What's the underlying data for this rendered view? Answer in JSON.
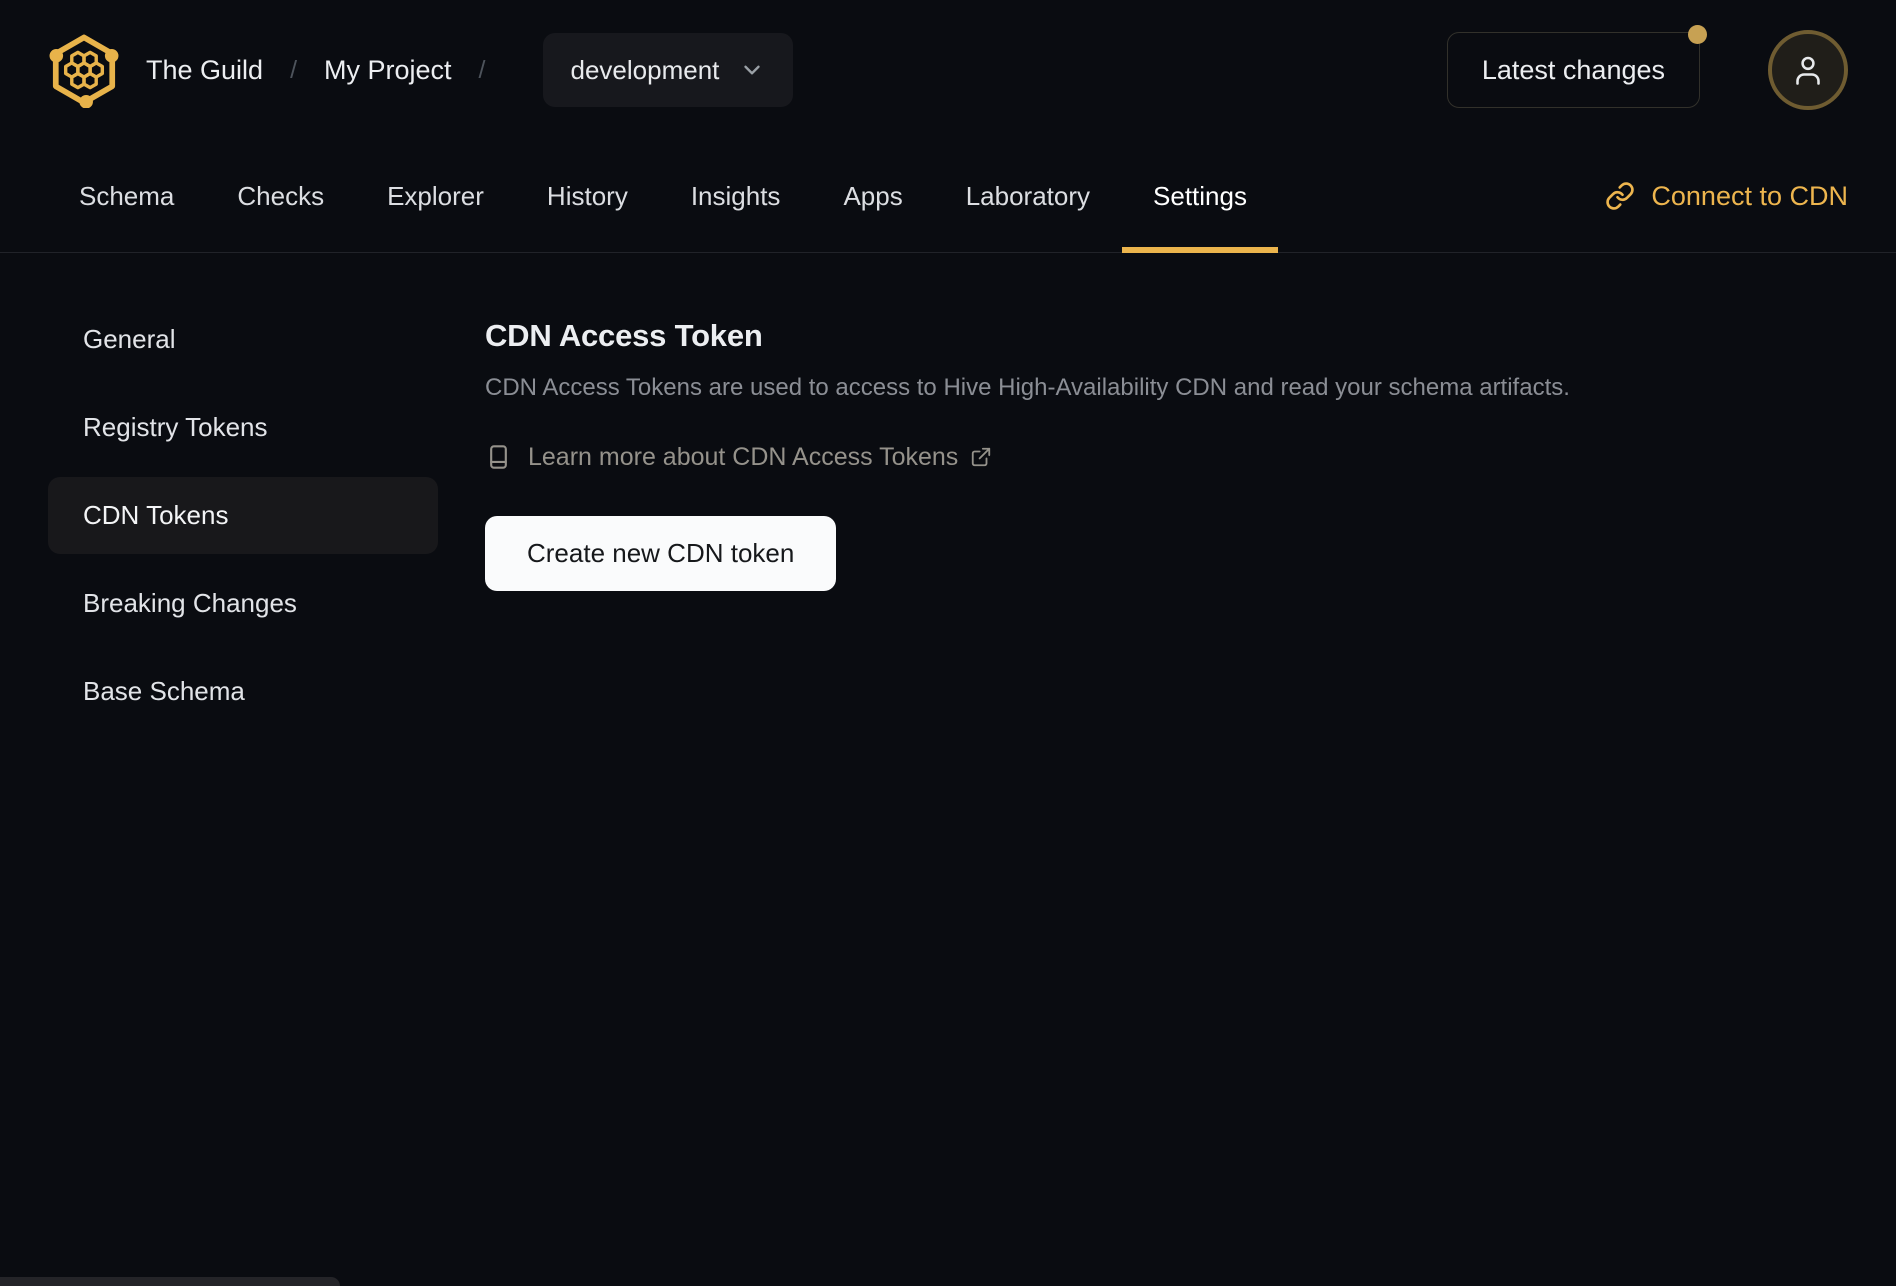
{
  "brand": {
    "org": "The Guild",
    "project": "My Project",
    "target": "development",
    "separator": "/"
  },
  "header": {
    "latest_changes_label": "Latest changes",
    "has_notification_dot": true
  },
  "tabs": {
    "items": [
      {
        "label": "Schema"
      },
      {
        "label": "Checks"
      },
      {
        "label": "Explorer"
      },
      {
        "label": "History"
      },
      {
        "label": "Insights"
      },
      {
        "label": "Apps"
      },
      {
        "label": "Laboratory"
      },
      {
        "label": "Settings"
      }
    ],
    "active": "Settings",
    "connect_cdn_label": "Connect to CDN"
  },
  "sidebar": {
    "items": [
      {
        "label": "General"
      },
      {
        "label": "Registry Tokens"
      },
      {
        "label": "CDN Tokens"
      },
      {
        "label": "Breaking Changes"
      },
      {
        "label": "Base Schema"
      }
    ],
    "active": "CDN Tokens"
  },
  "main": {
    "title": "CDN Access Token",
    "description": "CDN Access Tokens are used to access to Hive High-Availability CDN and read your schema artifacts.",
    "learn_more_label": "Learn more about CDN Access Tokens",
    "create_button_label": "Create new CDN token"
  },
  "colors": {
    "background": "#0a0c11",
    "accent_gold": "#ecb54d",
    "muted_gold_dot": "#c7a153",
    "panel": "#17181d",
    "sidebar_active": "#18181b",
    "text_primary": "#eceef1",
    "text_muted": "#8b8e95",
    "button_bg": "#fafbfc"
  }
}
